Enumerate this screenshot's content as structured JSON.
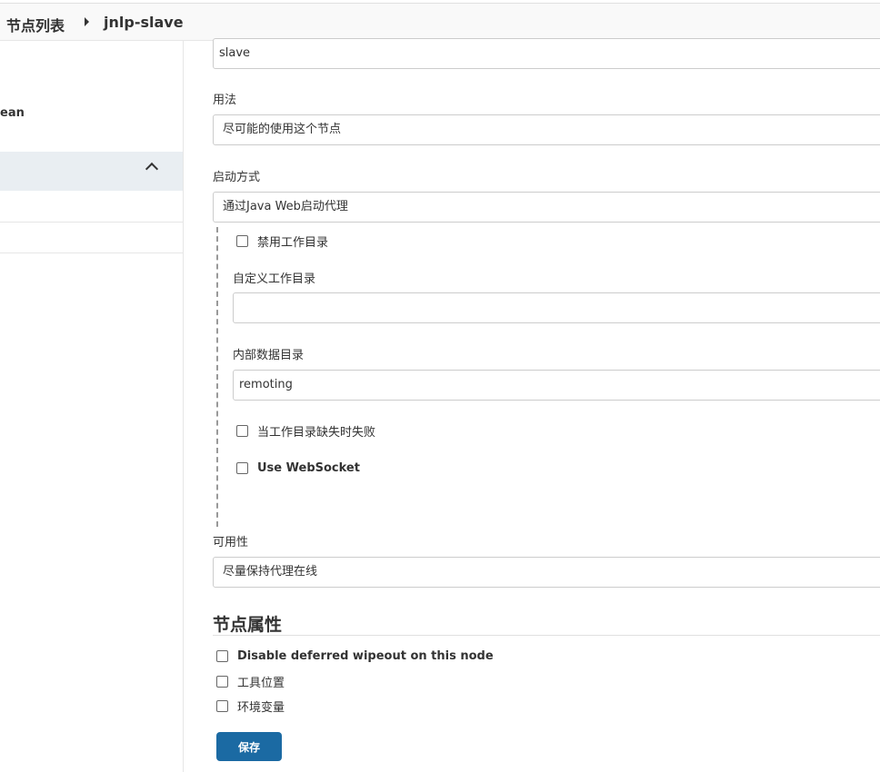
{
  "breadcrumb": {
    "items": [
      "节点列表",
      "jnlp-slave"
    ]
  },
  "sidebar": {
    "partial_item": "ean"
  },
  "form": {
    "name_value": "slave",
    "usage": {
      "label": "用法",
      "value": "尽可能的使用这个节点"
    },
    "launch": {
      "label": "启动方式",
      "value": "通过Java Web启动代理"
    },
    "disable_workdir": {
      "label": "禁用工作目录"
    },
    "custom_workdir": {
      "label": "自定义工作目录",
      "value": ""
    },
    "internal_dir": {
      "label": "内部数据目录",
      "value": "remoting"
    },
    "fail_if_missing": {
      "label": "当工作目录缺失时失败"
    },
    "websocket": {
      "label": "Use WebSocket"
    },
    "availability": {
      "label": "可用性",
      "value": "尽量保持代理在线"
    }
  },
  "node_properties": {
    "title": "节点属性",
    "options": [
      "Disable deferred wipeout on this node",
      "工具位置",
      "环境变量"
    ]
  },
  "actions": {
    "save_label": "保存"
  },
  "colors": {
    "primary_button": "#1b6aa3",
    "sidebar_panel": "#e9eef2"
  }
}
